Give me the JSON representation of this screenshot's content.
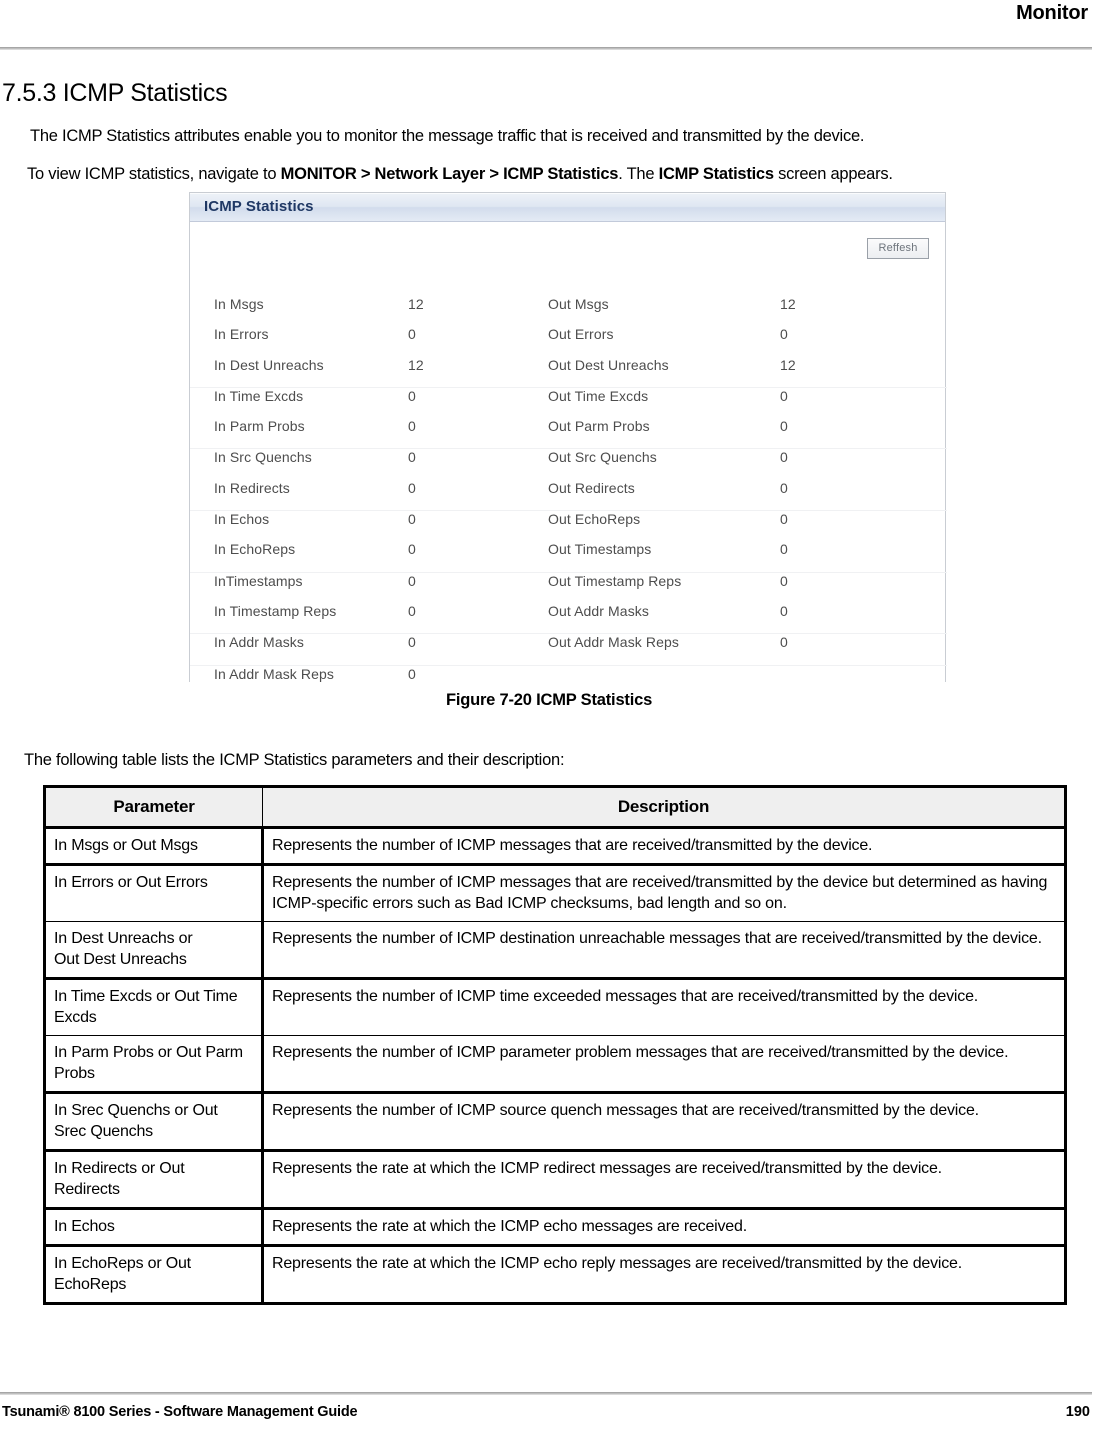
{
  "header": {
    "running_title": "Monitor"
  },
  "section": {
    "heading": "7.5.3 ICMP Statistics",
    "paragraph_1": "The ICMP Statistics attributes enable you to monitor the message traffic that is received and transmitted by the device.",
    "paragraph_2_parts": {
      "a": "To view ICMP statistics, navigate to ",
      "b1": "MONITOR > Network Layer > ICMP Statistics",
      "c": ". The ",
      "b2": "ICMP Statistics",
      "d": " screen appears."
    },
    "paragraph_3": "The following table lists the ICMP Statistics parameters and their description:"
  },
  "figure": {
    "caption": "Figure 7-20 ICMP Statistics",
    "app_title": "ICMP Statistics",
    "refresh_label": "Reffesh",
    "rows": [
      {
        "in_label": "In Msgs",
        "in_value": "12",
        "out_label": "Out Msgs",
        "out_value": "12"
      },
      {
        "in_label": "In Errors",
        "in_value": "0",
        "out_label": "Out Errors",
        "out_value": "0"
      },
      {
        "in_label": "In Dest Unreachs",
        "in_value": "12",
        "out_label": "Out Dest Unreachs",
        "out_value": "12"
      },
      {
        "in_label": "In Time Excds",
        "in_value": "0",
        "out_label": "Out Time Excds",
        "out_value": "0"
      },
      {
        "in_label": "In Parm Probs",
        "in_value": "0",
        "out_label": "Out Parm Probs",
        "out_value": "0"
      },
      {
        "in_label": "In Src Quenchs",
        "in_value": "0",
        "out_label": "Out Src Quenchs",
        "out_value": "0"
      },
      {
        "in_label": "In Redirects",
        "in_value": "0",
        "out_label": "Out Redirects",
        "out_value": "0"
      },
      {
        "in_label": "In Echos",
        "in_value": "0",
        "out_label": "Out EchoReps",
        "out_value": "0"
      },
      {
        "in_label": "In EchoReps",
        "in_value": "0",
        "out_label": "Out Timestamps",
        "out_value": "0"
      },
      {
        "in_label": "InTimestamps",
        "in_value": "0",
        "out_label": "Out Timestamp Reps",
        "out_value": "0"
      },
      {
        "in_label": "In Timestamp Reps",
        "in_value": "0",
        "out_label": "Out Addr Masks",
        "out_value": "0"
      },
      {
        "in_label": "In Addr Masks",
        "in_value": "0",
        "out_label": "Out Addr Mask Reps",
        "out_value": "0"
      },
      {
        "in_label": "In Addr Mask Reps",
        "in_value": "0",
        "out_label": "",
        "out_value": ""
      }
    ]
  },
  "table": {
    "headers": [
      "Parameter",
      "Description"
    ],
    "rows": [
      {
        "parameter": "In Msgs or Out Msgs",
        "description": "Represents the number of ICMP messages that are received/transmitted by the device."
      },
      {
        "parameter": "In Errors or Out Errors",
        "description": "Represents the number of ICMP messages that are received/transmitted by the device but determined as having ICMP-specific errors such as Bad ICMP checksums, bad length and so on."
      },
      {
        "parameter": "In Dest Unreachs or\nOut Dest Unreachs",
        "description": "Represents the number of ICMP destination unreachable messages that are received/transmitted by the device."
      },
      {
        "parameter": "In Time Excds or Out Time Excds",
        "description": "Represents the number of ICMP time exceeded messages that are received/transmitted by the device."
      },
      {
        "parameter": "In Parm Probs or Out Parm Probs",
        "description": "Represents the number of ICMP parameter problem messages that are received/transmitted by the device."
      },
      {
        "parameter": "In Srec Quenchs or Out Srec Quenchs",
        "description": "Represents the number of ICMP source quench messages that are received/transmitted by the device."
      },
      {
        "parameter": "In Redirects or Out Redirects",
        "description": "Represents the rate at which the ICMP redirect messages are received/transmitted by the device."
      },
      {
        "parameter": "In Echos",
        "description": "Represents the rate at which the ICMP echo messages are received."
      },
      {
        "parameter": "In EchoReps or Out EchoReps",
        "description": "Represents the rate at which the ICMP echo reply messages are received/transmitted by the device."
      }
    ]
  },
  "footer": {
    "left": "Tsunami® 8100 Series - Software Management Guide",
    "page_number": "190"
  }
}
